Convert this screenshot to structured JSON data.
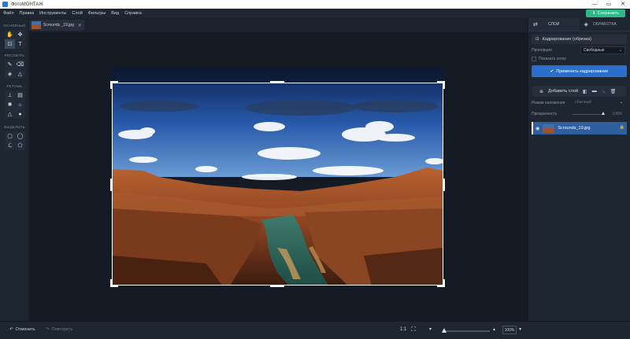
{
  "titlebar": {
    "title": "ФотоМОНТАЖ",
    "controls": [
      "—",
      "▭",
      "✕"
    ]
  },
  "menu": {
    "items": [
      "Файл",
      "Правка",
      "Инструменты",
      "Слой",
      "Фильтры",
      "Вид",
      "Справка"
    ]
  },
  "save_button": {
    "label": "Сохранить"
  },
  "document_tab": {
    "name": "Scrounds _19.jpg",
    "close": "✕"
  },
  "toolbar": {
    "groups": [
      {
        "label": "ОСНОВНЫЕ"
      },
      {
        "label": "РИСОВАТЬ"
      },
      {
        "label": "РЕТУШЬ"
      },
      {
        "label": "ВЫДЕЛИТЬ"
      }
    ]
  },
  "bottom": {
    "undo_label": "Отменить",
    "redo_label": "Повторить",
    "zoom_ratio": "1:1",
    "zoom_value": "100%",
    "zoom_level": 0.08
  },
  "right_panel": {
    "tabs": [
      "СЛОИ",
      "ОБРАБОТКА"
    ],
    "crop_header": "Кадрирование (обрезка)",
    "proportions_label": "Пропорции",
    "proportions_value": "Свободные",
    "show_grid_label": "Показать сетку",
    "apply_label": "Применить кадрирование",
    "add_layer_label": "Добавить слой",
    "blend_mode_label": "Режим наложения",
    "blend_mode_value": "обычный",
    "opacity_label": "Прозрачность",
    "opacity_value": "100%",
    "opacity_level": 1.0,
    "layer_name": "Scrounds_19.jpg"
  },
  "colors": {
    "accent_blue": "#2a6fcb",
    "save_green": "#2fb88a",
    "panel_bg": "#1e2631",
    "canvas_bg": "#151b25"
  }
}
